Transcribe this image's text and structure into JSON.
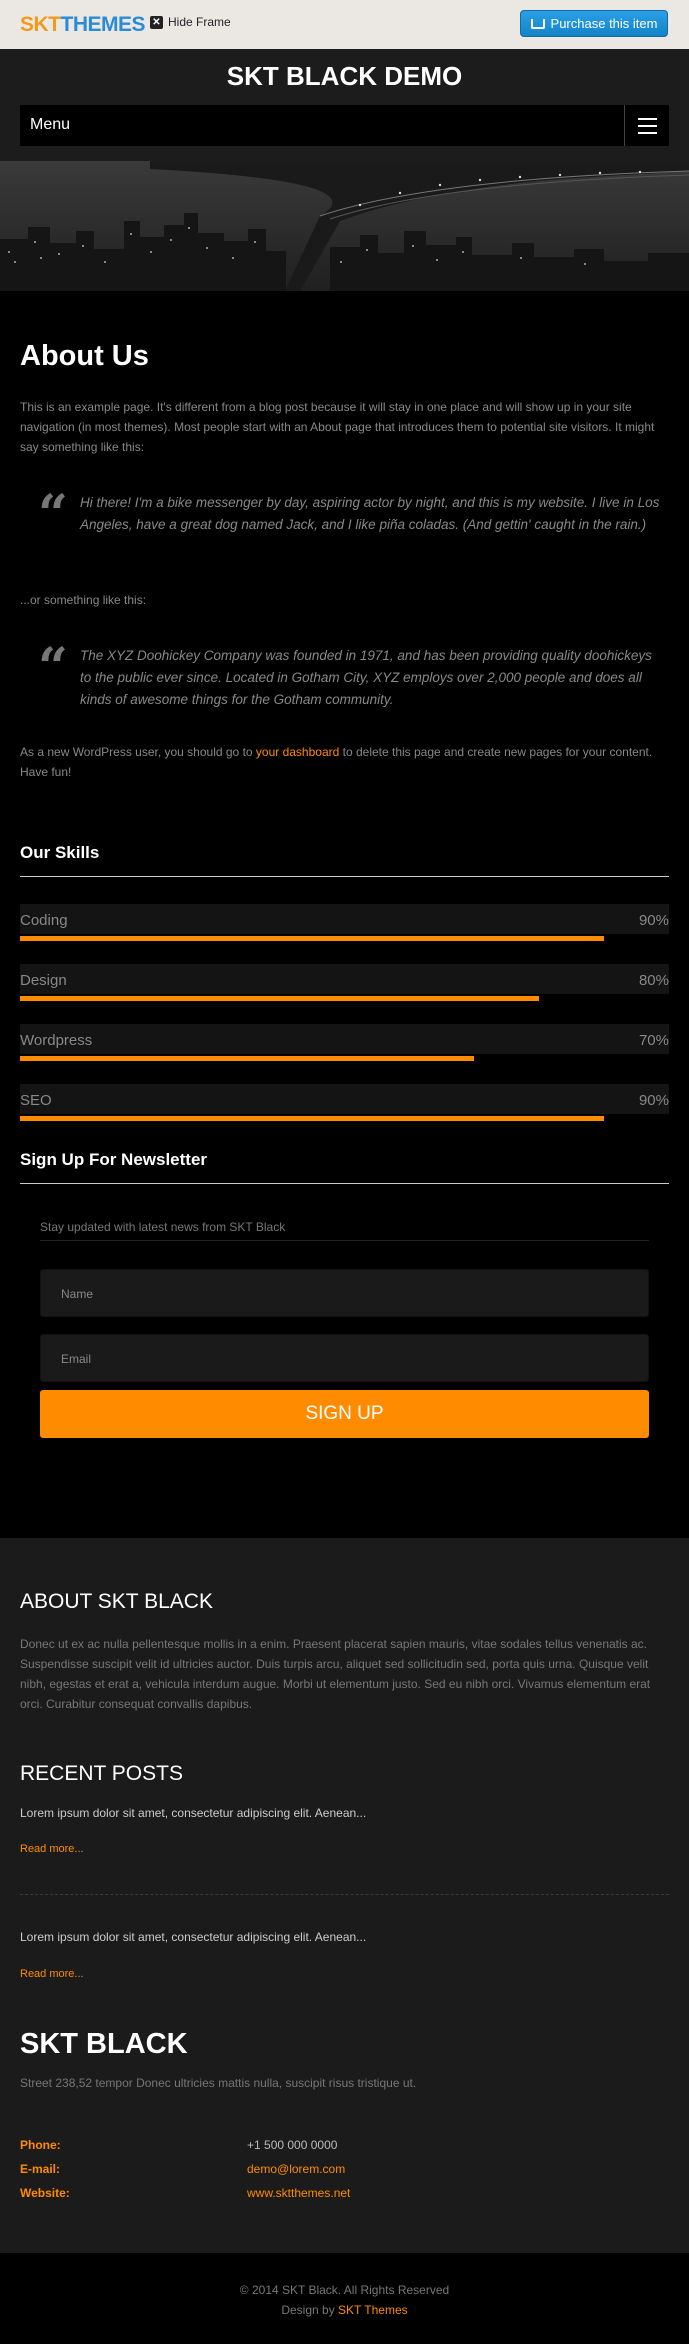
{
  "topbar": {
    "logo_skt": "SKT",
    "logo_themes": "THEMES",
    "hide_frame": "Hide Frame",
    "purchase": "Purchase this item"
  },
  "header": {
    "site_title": "SKT BLACK DEMO",
    "menu_label": "Menu"
  },
  "page": {
    "title": "About Us",
    "intro": "This is an example page. It's different from a blog post because it will stay in one place and will show up in your site navigation (in most themes). Most people start with an About page that introduces them to potential site visitors. It might say something like this:",
    "quote1": "Hi there! I'm a bike messenger by day, aspiring actor by night, and this is my website. I live in Los Angeles, have a great dog named Jack, and I like piña coladas. (And gettin' caught in the rain.)",
    "or_text": "...or something like this:",
    "quote2": "The XYZ Doohickey Company was founded in 1971, and has been providing quality doohickeys to the public ever since. Located in Gotham City, XYZ employs over 2,000 people and does all kinds of awesome things for the Gotham community.",
    "closing_before": "As a new WordPress user, you should go to ",
    "closing_link": "your dashboard",
    "closing_after": " to delete this page and create new pages for your content. Have fun!"
  },
  "skills": {
    "title": "Our Skills",
    "items": [
      {
        "name": "Coding",
        "label": "90%",
        "value": 0.9
      },
      {
        "name": "Design",
        "label": "80%",
        "value": 0.8
      },
      {
        "name": "Wordpress",
        "label": "70%",
        "value": 0.7
      },
      {
        "name": "SEO",
        "label": "90%",
        "value": 0.9
      }
    ]
  },
  "newsletter": {
    "title": "Sign Up For Newsletter",
    "note": "Stay updated with latest news from SKT Black",
    "name_placeholder": "Name",
    "email_placeholder": "Email",
    "button": "SIGN UP"
  },
  "footer": {
    "about_title": "ABOUT SKT BLACK",
    "about_text": "Donec ut ex ac nulla pellentesque mollis in a enim. Praesent placerat sapien mauris, vitae sodales tellus venenatis ac. Suspendisse suscipit velit id ultricies auctor. Duis turpis arcu, aliquet sed sollicitudin sed, porta quis urna. Quisque velit nibh, egestas et erat a, vehicula interdum augue. Morbi ut elementum justo. Sed eu nibh orci. Vivamus elementum erat orci. Curabitur consequat convallis dapibus.",
    "recent_title": "RECENT POSTS",
    "posts": [
      {
        "excerpt": "Lorem ipsum dolor sit amet, consectetur adipiscing elit. Aenean...",
        "read_more": "Read more..."
      },
      {
        "excerpt": "Lorem ipsum dolor sit amet, consectetur adipiscing elit. Aenean...",
        "read_more": "Read more..."
      }
    ],
    "brand": "SKT BLACK",
    "address": "Street 238,52 tempor Donec ultricies mattis nulla, suscipit risus tristique ut.",
    "phone_label": "Phone:",
    "phone": "+1 500 000 0000",
    "email_label": "E-mail:",
    "email": "demo@lorem.com",
    "website_label": "Website:",
    "website": "www.sktthemes.net"
  },
  "copyright": {
    "line1": "© 2014 SKT Black. All Rights Reserved",
    "design_by": "Design by ",
    "design_link": "SKT Themes"
  },
  "colors": {
    "accent": "#ff8c00",
    "background": "#000000",
    "panel": "#1b1b1b"
  }
}
